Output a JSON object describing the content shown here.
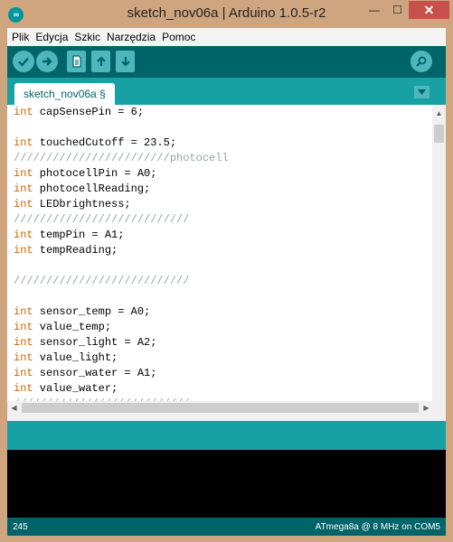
{
  "window": {
    "title": "sketch_nov06a | Arduino 1.0.5-r2",
    "icon": "arduino-logo-icon",
    "icon_glyph": "∞",
    "minimize_glyph": "—",
    "maximize_glyph": "☐",
    "close_glyph": "✕"
  },
  "menu": [
    {
      "label": "Plik"
    },
    {
      "label": "Edycja"
    },
    {
      "label": "Szkic"
    },
    {
      "label": "Narzędzia"
    },
    {
      "label": "Pomoc"
    }
  ],
  "toolbar": {
    "buttons": [
      "verify-icon",
      "upload-icon",
      "new-icon",
      "open-icon",
      "save-icon",
      "serial-monitor-icon"
    ]
  },
  "tab": {
    "label": "sketch_nov06a §"
  },
  "code": [
    {
      "kw": "int",
      "rest": " capSensePin = 6;"
    },
    {
      "kw": "",
      "rest": ""
    },
    {
      "kw": "int",
      "rest": " touchedCutoff = 23.5;"
    },
    {
      "kw": "",
      "rest": "",
      "comment": "////////////////////////photocell"
    },
    {
      "kw": "int",
      "rest": " photocellPin = A0;"
    },
    {
      "kw": "int",
      "rest": " photocellReading;"
    },
    {
      "kw": "int",
      "rest": " LEDbrightness;"
    },
    {
      "kw": "",
      "rest": "",
      "comment": "///////////////////////////"
    },
    {
      "kw": "int",
      "rest": " tempPin = A1;"
    },
    {
      "kw": "int",
      "rest": " tempReading;"
    },
    {
      "kw": "",
      "rest": ""
    },
    {
      "kw": "",
      "rest": "",
      "comment": "///////////////////////////"
    },
    {
      "kw": "",
      "rest": ""
    },
    {
      "kw": "int",
      "rest": " sensor_temp = A0;"
    },
    {
      "kw": "int",
      "rest": " value_temp;"
    },
    {
      "kw": "int",
      "rest": " sensor_light = A2;"
    },
    {
      "kw": "int",
      "rest": " value_light;"
    },
    {
      "kw": "int",
      "rest": " sensor_water = A1;"
    },
    {
      "kw": "int",
      "rest": " value_water;"
    },
    {
      "kw": "",
      "rest": "",
      "comment": "///////////////////////////"
    }
  ],
  "status": {
    "line": "245",
    "board": "ATmega8a @ 8 MHz on COM5"
  },
  "colors": {
    "toolbar": "#006468",
    "tabbar": "#17a1a5",
    "keyword": "#cc6600",
    "comment": "#95a5a6"
  }
}
